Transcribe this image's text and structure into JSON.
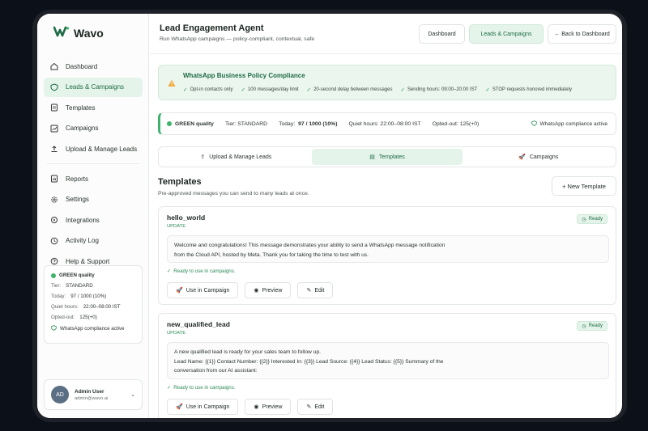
{
  "app": {
    "name": "Wavo",
    "logo_mark": "W"
  },
  "sidebar": {
    "items": [
      {
        "label": "Dashboard",
        "icon": "home-icon"
      },
      {
        "label": "Leads & Campaigns",
        "icon": "shield-icon",
        "active": true
      },
      {
        "label": "Templates",
        "icon": "document-icon"
      },
      {
        "label": "Campaigns",
        "icon": "chart-icon"
      },
      {
        "label": "Upload & Manage Leads",
        "icon": "upload-icon"
      }
    ],
    "items2": [
      {
        "label": "Reports",
        "icon": "report-icon"
      },
      {
        "label": "Settings",
        "icon": "gear-icon"
      },
      {
        "label": "Integrations",
        "icon": "plug-icon"
      },
      {
        "label": "Activity Log",
        "icon": "clock-icon"
      },
      {
        "label": "Help & Support",
        "icon": "help-icon"
      }
    ],
    "card": {
      "quality": "GREEN quality",
      "tier_label": "Tier:",
      "tier": "STANDARD",
      "today_label": "Today:",
      "today": "97 / 1000 (10%)",
      "quiet_label": "Quiet hours:",
      "quiet": "22:00–08:00 IST",
      "opted_label": "Opted-out:",
      "opted": "125(+0)",
      "compliance": "WhatsApp compliance active"
    },
    "user": {
      "initials": "AD",
      "name": "Admin User",
      "email": "admin@wavo.ai"
    }
  },
  "header": {
    "title": "Lead Engagement Agent",
    "subtitle": "Run WhatsApp campaigns — policy-compliant, contextual, safe",
    "btn_dashboard": "Dashboard",
    "btn_leads": "Leads & Campaigns",
    "btn_back": "← Back to Dashboard"
  },
  "policy": {
    "title": "WhatsApp Business Policy Compliance",
    "items": [
      "Opt-in contacts only",
      "100 messages/day limit",
      "20-second delay between messages",
      "Sending hours: 09:00–20:00 IST",
      "STOP requests honored immediately"
    ]
  },
  "status": {
    "quality": "GREEN quality",
    "tier": "Tier: STANDARD",
    "today_label": "Today:",
    "today": "97 / 1000 (10%)",
    "quiet": "Quiet hours: 22:00–08:00 IST",
    "opted": "Opted-out:  125(+0)",
    "compliance": "WhatsApp compliance active"
  },
  "tabs": [
    "Upload & Manage Leads",
    "Templates",
    "Campaigns"
  ],
  "templates_section": {
    "title": "Templates",
    "subtitle": "Pre-approved messages you can send to many leads at once.",
    "new_button": "+ New Template"
  },
  "templates": [
    {
      "name": "hello_world",
      "category": "UPDATE",
      "status": "Ready",
      "body_lines": [
        "Welcome and congratulations! This message demonstrates your ability to send a WhatsApp message notification",
        "from the Cloud API, hosted by Meta. Thank you for taking the time to test with us."
      ],
      "ready_text": "Ready to use in campaigns."
    },
    {
      "name": "new_qualified_lead",
      "category": "UPDATE",
      "status": "Ready",
      "body_lines": [
        "A new qualified lead is ready for your sales team to follow up.",
        "Lead Name:  {{1}}   Contact Number:  {{2}}   Interested In:  {{3}}   Lead Source:  {{4}}   Lead Status:  {{5}}   Summary of the",
        "conversation from our AI assistant:"
      ],
      "ready_text": "Ready to use in campaigns."
    }
  ],
  "actions": {
    "use": "Use in Campaign",
    "preview": "Preview",
    "edit": "Edit"
  },
  "colors": {
    "accent": "#1f6b45",
    "accent_bg": "#e4f4ea",
    "status_green": "#3fb46b"
  }
}
